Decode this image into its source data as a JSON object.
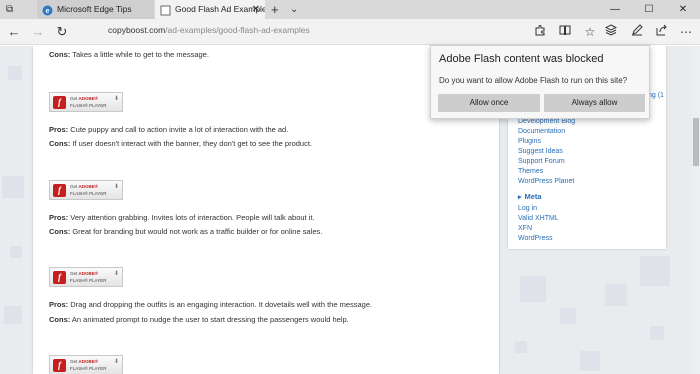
{
  "tabs": [
    {
      "title": "Microsoft Edge Tips",
      "active": false
    },
    {
      "title": "Good Flash Ad Example",
      "active": true
    }
  ],
  "tab_actions": {
    "new_tab": "+",
    "list_tabs": "⌄"
  },
  "window_controls": {
    "minimize": "—",
    "maximize": "☐",
    "close": "✕"
  },
  "nav": {
    "back": "←",
    "forward": "→",
    "refresh": "↻",
    "address_domain": "copyboost.com",
    "address_path": "/ad-examples/good-flash-ad-examples"
  },
  "toolbar_icons": [
    "puzzle-icon",
    "reading-view-icon",
    "favorite-star-icon",
    "hub-icon",
    "notes-icon",
    "share-icon",
    "more-icon"
  ],
  "content": {
    "items": [
      {
        "kind": "cons",
        "label": "Cons:",
        "text": " Takes a little while to get to the message."
      },
      {
        "kind": "flash"
      },
      {
        "kind": "pros",
        "label": "Pros:",
        "text": " Cute puppy and call to action invite a lot of interaction with the ad."
      },
      {
        "kind": "cons",
        "label": "Cons:",
        "text": " If user doesn't interact with the banner, they don't get to see the product."
      },
      {
        "kind": "flash"
      },
      {
        "kind": "pros",
        "label": "Pros:",
        "text": " Very attention grabbing. Invites lots of interaction. People will talk about it."
      },
      {
        "kind": "cons",
        "label": "Cons:",
        "text": " Great for branding but would not work as a traffic builder or for online sales."
      },
      {
        "kind": "flash"
      },
      {
        "kind": "pros",
        "label": "Pros:",
        "text": " Drag and dropping the outfits is an engaging interaction. It dovetails well with the message."
      },
      {
        "kind": "cons",
        "label": "Cons:",
        "text": " An animated prompt to nudge the user to start dressing the passengers would help."
      },
      {
        "kind": "flash"
      }
    ],
    "flash_button": {
      "line1_prefix": "Get ",
      "line1_brand": "ADOBE®",
      "line2": "FLASH® PLAYER",
      "logo": "f"
    }
  },
  "sidebar": {
    "partial_text": "ng (1",
    "links": [
      "Development Blog",
      "Documentation",
      "Plugins",
      "Suggest Ideas",
      "Support Forum",
      "Themes",
      "WordPress Planet"
    ],
    "meta_heading": "Meta",
    "meta_links": [
      "Log in",
      "Valid XHTML",
      "XFN",
      "WordPress"
    ]
  },
  "flash_prompt": {
    "title": "Adobe Flash content was blocked",
    "question": "Do you want to allow Adobe Flash to run on this site?",
    "allow_once": "Allow once",
    "always_allow": "Always allow"
  },
  "colors": {
    "link": "#2a6fb5",
    "flash_red": "#c41e1e",
    "tab_bar": "#d9d9d9",
    "page_bg": "#e8ecef"
  }
}
